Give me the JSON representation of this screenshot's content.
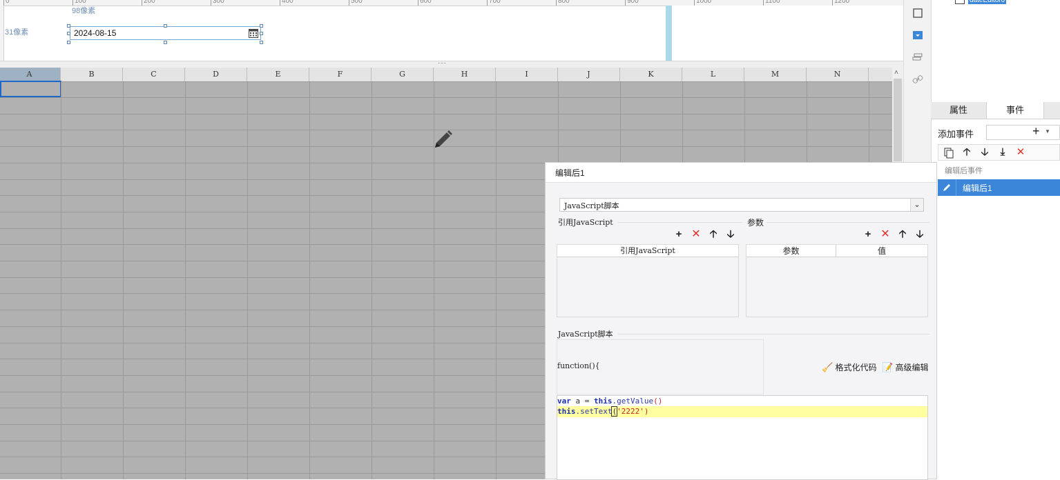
{
  "ruler": {
    "ticks": [
      "0",
      "100",
      "200",
      "300",
      "400",
      "500",
      "600",
      "700",
      "800",
      "900",
      "1000",
      "1100",
      "1200"
    ]
  },
  "design": {
    "dim_top": "98像素",
    "dim_left": "31像素",
    "date_value": "2024-08-15"
  },
  "sheet": {
    "columns": [
      "A",
      "B",
      "C",
      "D",
      "E",
      "F",
      "G",
      "H",
      "I",
      "J",
      "K",
      "L",
      "M",
      "N"
    ],
    "selected_cell": "A1"
  },
  "tree": {
    "node_label": "dateEditor0"
  },
  "panel": {
    "tabs": [
      "属性",
      "事件"
    ],
    "active_tab": "事件",
    "add_event_label": "添加事件",
    "event_group_label": "编辑后事件",
    "event_item_label": "编辑后1"
  },
  "dialog": {
    "title": "编辑后1",
    "type_value": "JavaScript脚本",
    "ref_js_title": "引用JavaScript",
    "params_title": "参数",
    "ref_js_col": "引用JavaScript",
    "param_col": "参数",
    "value_col": "值",
    "script_title": "JavaScript脚本",
    "func_header": "function(){",
    "format_code_label": "格式化代码",
    "advanced_edit_label": "高级编辑",
    "code_line1": [
      "var",
      " a = ",
      "this",
      ".getValue",
      "()"
    ],
    "code_line2": [
      "this",
      ".setText",
      "(",
      "'2222'",
      ")"
    ]
  },
  "colors": {
    "accent": "#3c86d9",
    "sheet_bg": "#b1b1b1",
    "delete_red": "#e0322c",
    "highlight_line": "#ffff9f"
  }
}
